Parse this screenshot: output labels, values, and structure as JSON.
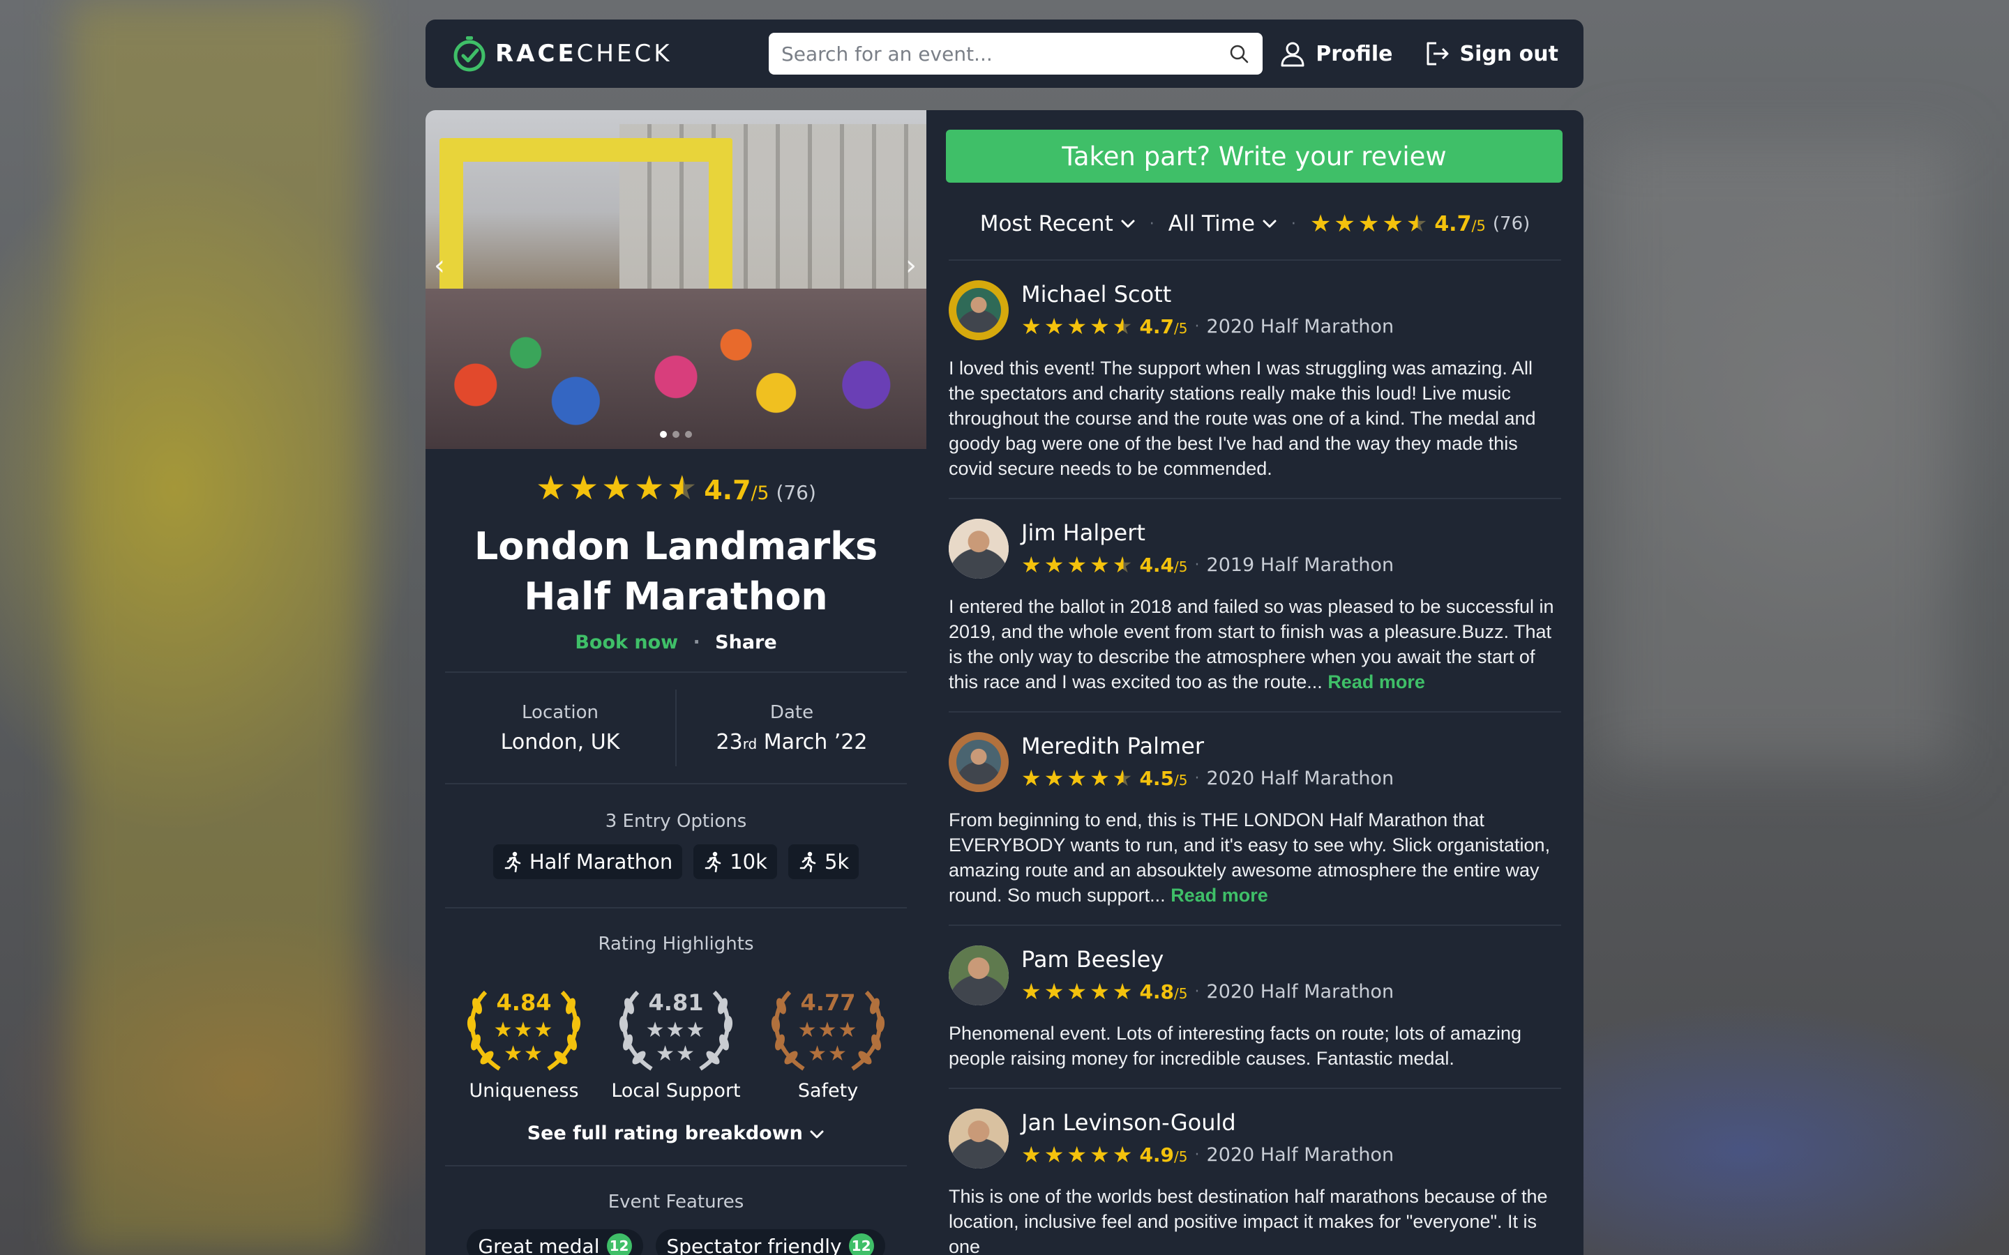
{
  "header": {
    "logo_bold": "RACE",
    "logo_light": "CHECK",
    "search_placeholder": "Search for an event...",
    "profile_label": "Profile",
    "signout_label": "Sign out"
  },
  "event": {
    "rating": "4.7",
    "rating_den": "/5",
    "rating_count": "(76)",
    "title_line1": "London Landmarks",
    "title_line2": "Half Marathon",
    "book_label": "Book now",
    "share_label": "Share",
    "location_label": "Location",
    "location_value": "London, UK",
    "date_label": "Date",
    "date_day": "23",
    "date_suffix": "rd",
    "date_rest": " March ’22",
    "entry_options_label": "3 Entry Options",
    "entry_options": [
      "Half Marathon",
      "10k",
      "5k"
    ],
    "highlights_label": "Rating Highlights",
    "highlights": [
      {
        "score": "4.84",
        "name": "Uniqueness",
        "tier": "gold"
      },
      {
        "score": "4.81",
        "name": "Local Support",
        "tier": "silver"
      },
      {
        "score": "4.77",
        "name": "Safety",
        "tier": "bronze"
      }
    ],
    "see_full_label": "See full rating breakdown",
    "features_label": "Event Features",
    "features": [
      {
        "label": "Great medal",
        "count": "12"
      },
      {
        "label": "Spectator friendly",
        "count": "12"
      }
    ]
  },
  "reviews_panel": {
    "write_review_label": "Taken part? Write your review",
    "sort_label": "Most Recent",
    "period_label": "All Time",
    "rating": "4.7",
    "rating_den": "/5",
    "rating_count": "(76)"
  },
  "reviews": [
    {
      "name": "Michael Scott",
      "score": "4.7",
      "den": "/5",
      "stars": 4.5,
      "event": "2020 Half Marathon",
      "text": "I loved this event! The support when I was struggling was amazing. All the spectators and charity stations really make this loud! Live music throughout the course and the route was one of a kind. The medal and goody bag were one of the best I've had and the way they made this covid secure needs to be commended.",
      "more": "",
      "badge": "gold"
    },
    {
      "name": "Jim Halpert",
      "score": "4.4",
      "den": "/5",
      "stars": 4.5,
      "event": "2019 Half Marathon",
      "text": "I entered the ballot in 2018 and failed so was pleased to be successful in 2019, and the whole event from start to finish was a pleasure.Buzz. That is the only way to describe the atmosphere when you await the start of this race and I was excited too as the route...",
      "more": "Read more",
      "badge": "none"
    },
    {
      "name": "Meredith Palmer",
      "score": "4.5",
      "den": "/5",
      "stars": 4.5,
      "event": "2020 Half Marathon",
      "text": "From beginning to end, this is THE LONDON Half Marathon that EVERYBODY wants to run, and it's easy to see why. Slick organistation, amazing route and an absouktely awesome atmosphere the entire way round. So much support...",
      "more": "Read more",
      "badge": "bronze"
    },
    {
      "name": "Pam Beesley",
      "score": "4.8",
      "den": "/5",
      "stars": 5,
      "event": "2020 Half Marathon",
      "text": "Phenomenal event. Lots of interesting facts on route; lots of amazing people raising money for incredible causes. Fantastic medal.",
      "more": "",
      "badge": "none"
    },
    {
      "name": "Jan Levinson-Gould",
      "score": "4.9",
      "den": "/5",
      "stars": 5,
      "event": "2020 Half Marathon",
      "text": "This is one of the worlds best destination half marathons because of the location, inclusive feel and positive impact it makes for \"everyone\".  It is one",
      "more": "",
      "badge": "none"
    }
  ],
  "colors": {
    "accent_green": "#3fbf68",
    "star_yellow": "#f4c20d",
    "panel_bg": "#1f2633",
    "chip_bg": "#141b26"
  }
}
